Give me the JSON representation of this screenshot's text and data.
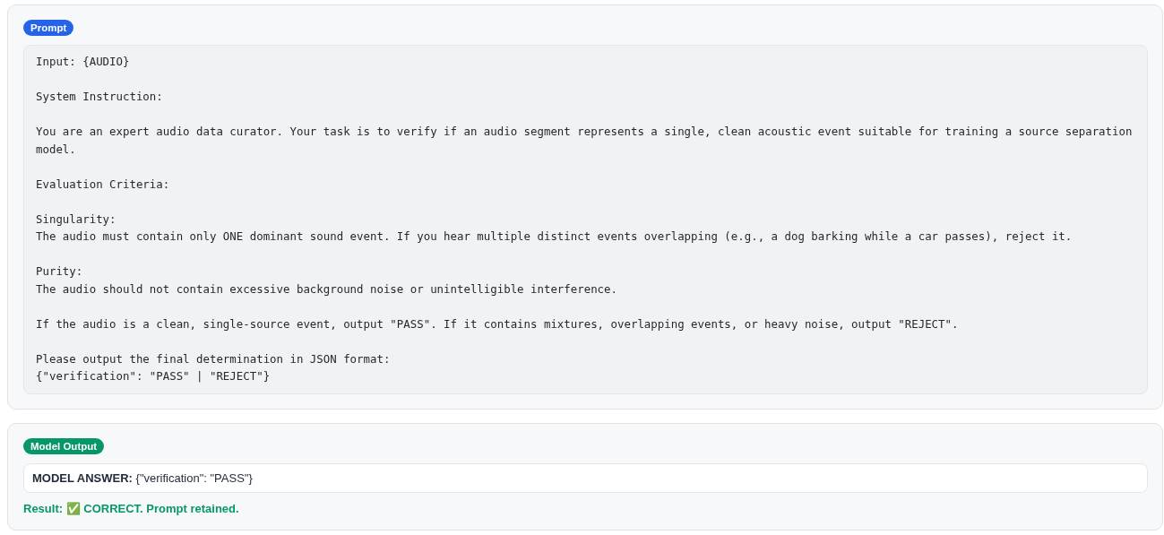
{
  "prompt_card": {
    "badge": "Prompt",
    "paragraphs": [
      [
        "Input: {AUDIO}"
      ],
      [
        "System Instruction:"
      ],
      [
        "You are an expert audio data curator. Your task is to verify if an audio segment represents a single, clean acoustic event suitable for training a source separation model."
      ],
      [
        "Evaluation Criteria:"
      ],
      [
        "Singularity:",
        "The audio must contain only ONE dominant sound event. If you hear multiple distinct events overlapping (e.g., a dog barking while a car passes), reject it."
      ],
      [
        "Purity:",
        "The audio should not contain excessive background noise or unintelligible interference."
      ],
      [
        "If the audio is a clean, single-source event, output \"PASS\". If it contains mixtures, overlapping events, or heavy noise, output \"REJECT\"."
      ],
      [
        "Please output the final determination in JSON format:",
        "{\"verification\": \"PASS\" | \"REJECT\"}"
      ]
    ]
  },
  "output_card": {
    "badge": "Model Output",
    "answer": "**MODEL ANSWER:** {\"verification\": \"PASS\"}",
    "result": "Result: ✅ CORRECT. Prompt retained."
  }
}
